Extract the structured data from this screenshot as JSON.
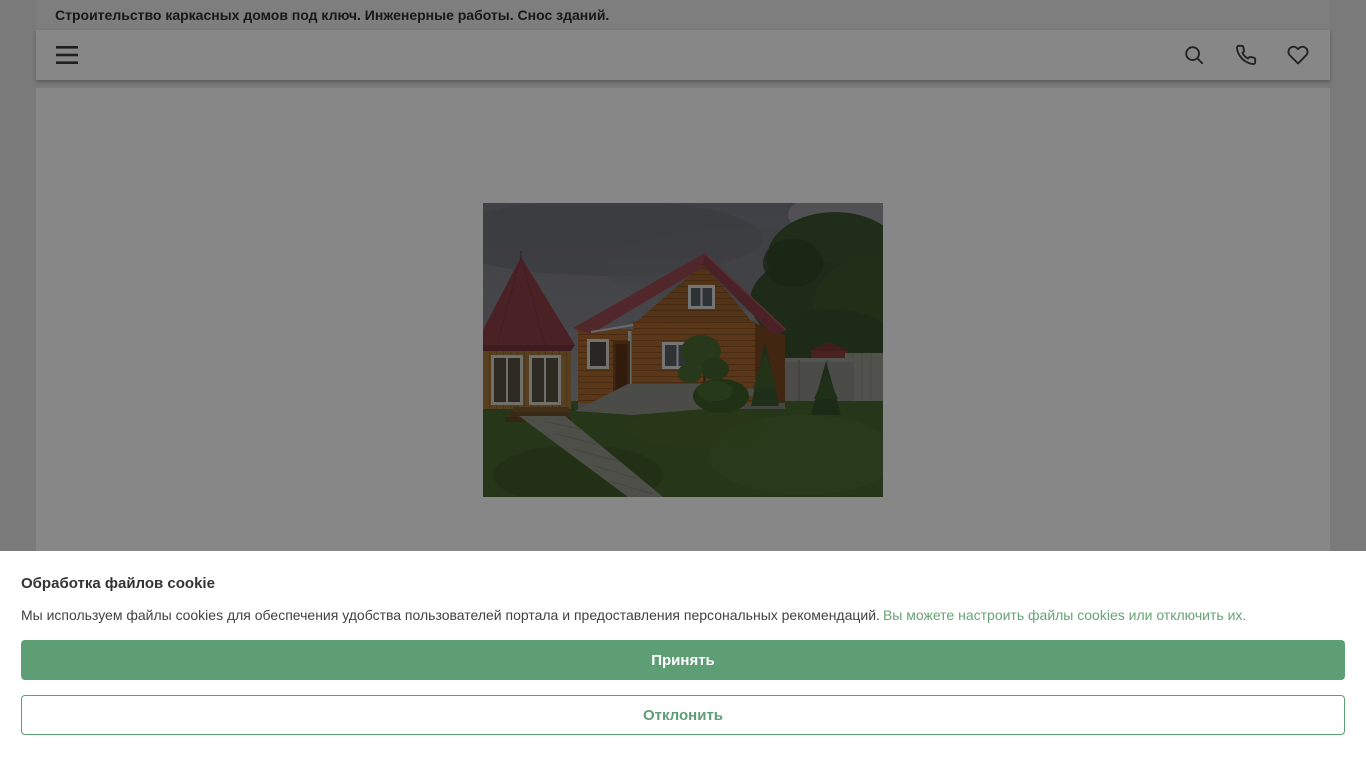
{
  "topbar": {
    "title": "Строительство каркасных домов под ключ. Инженерные работы. Снос зданий."
  },
  "header": {
    "icons": {
      "menu": "menu-icon",
      "search": "search-icon",
      "phone": "phone-icon",
      "favorites": "heart-icon"
    }
  },
  "cookie_banner": {
    "title": "Обработка файлов cookie",
    "message": "Мы используем файлы cookies для обеспечения удобства пользователей портала и предоставления персональных рекомендаций.",
    "link_text": "Вы можете настроить файлы cookies или отключить их.",
    "accept_label": "Принять",
    "decline_label": "Отклонить"
  },
  "colors": {
    "accent_green": "#5d9e74",
    "link_green": "#67a377"
  }
}
